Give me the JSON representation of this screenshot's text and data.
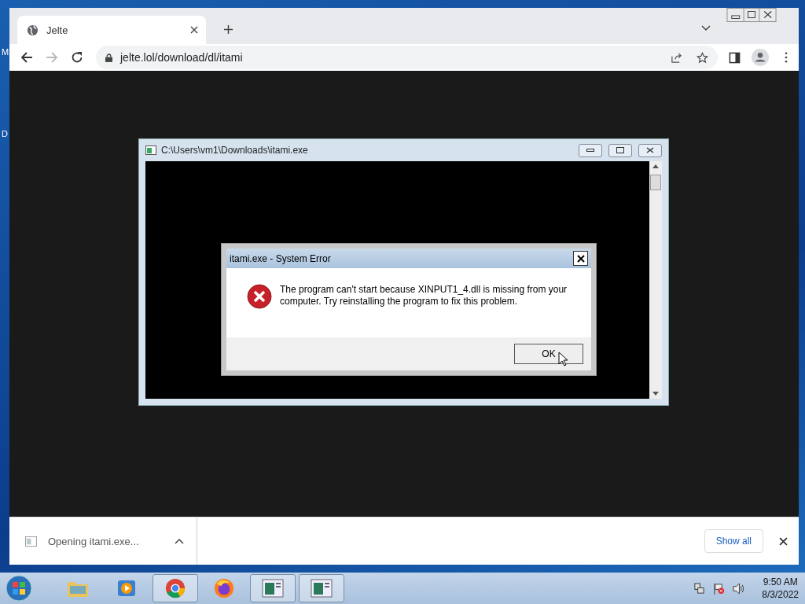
{
  "desktop": {
    "labels": [
      "M",
      "D"
    ]
  },
  "browser": {
    "tab": {
      "title": "Jelte"
    },
    "address": "jelte.lol/download/dl/itami"
  },
  "console_window": {
    "title": "C:\\Users\\vm1\\Downloads\\itami.exe"
  },
  "dialog": {
    "title": "itami.exe - System Error",
    "message": "The program can't start because XINPUT1_4.dll is missing from your computer. Try reinstalling the program to fix this problem.",
    "button": "OK"
  },
  "download_bar": {
    "item": "Opening itami.exe...",
    "show_all": "Show all"
  },
  "taskbar": {
    "items": [
      {
        "kind": "explorer",
        "running": false
      },
      {
        "kind": "media",
        "running": false
      },
      {
        "kind": "chrome",
        "running": true
      },
      {
        "kind": "firefox",
        "running": false
      },
      {
        "kind": "console",
        "running": true
      },
      {
        "kind": "console",
        "running": true
      }
    ],
    "time": "9:50 AM",
    "date": "8/3/2022"
  }
}
